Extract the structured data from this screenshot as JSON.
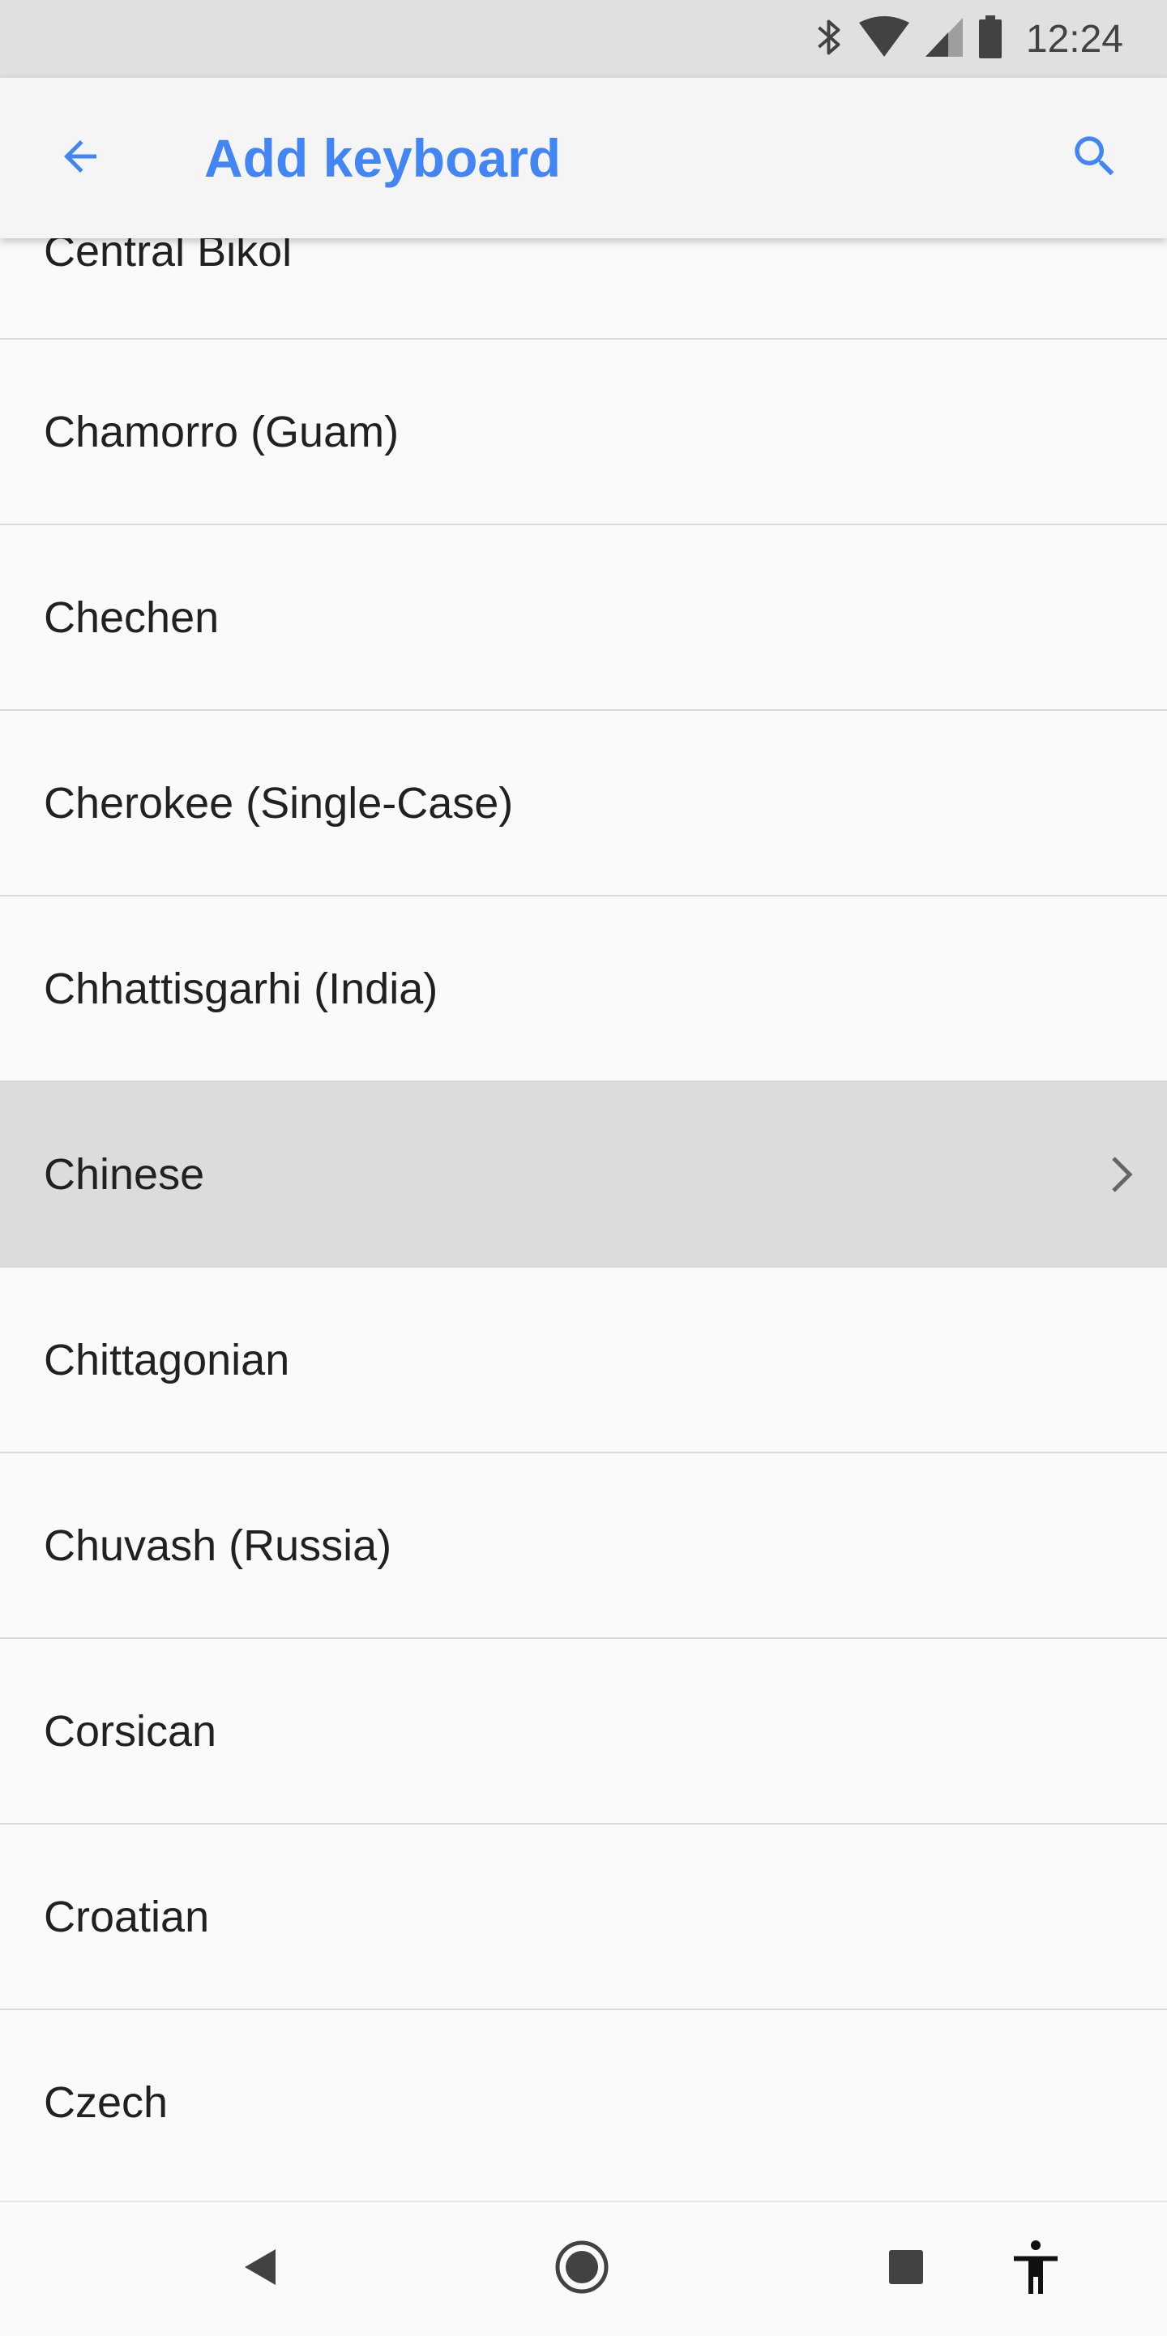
{
  "status_bar": {
    "time": "12:24",
    "icons": [
      "bluetooth-icon",
      "wifi-icon",
      "cell-signal-icon",
      "battery-icon"
    ]
  },
  "app_bar": {
    "title": "Add keyboard",
    "back_icon": "arrow-back-icon",
    "search_icon": "search-icon",
    "accent_color": "#4285f4"
  },
  "languages": {
    "items": [
      {
        "label": "Central Bikol"
      },
      {
        "label": "Chamorro (Guam)"
      },
      {
        "label": "Chechen"
      },
      {
        "label": "Cherokee (Single-Case)"
      },
      {
        "label": "Chhattisgarhi (India)"
      },
      {
        "label": "Chinese",
        "has_submenu": true,
        "highlighted": true
      },
      {
        "label": "Chittagonian"
      },
      {
        "label": "Chuvash (Russia)"
      },
      {
        "label": "Corsican"
      },
      {
        "label": "Croatian"
      },
      {
        "label": "Czech"
      }
    ]
  },
  "nav_bar": {
    "icons": [
      "back-triangle-icon",
      "home-circle-icon",
      "recents-square-icon",
      "accessibility-icon"
    ]
  }
}
